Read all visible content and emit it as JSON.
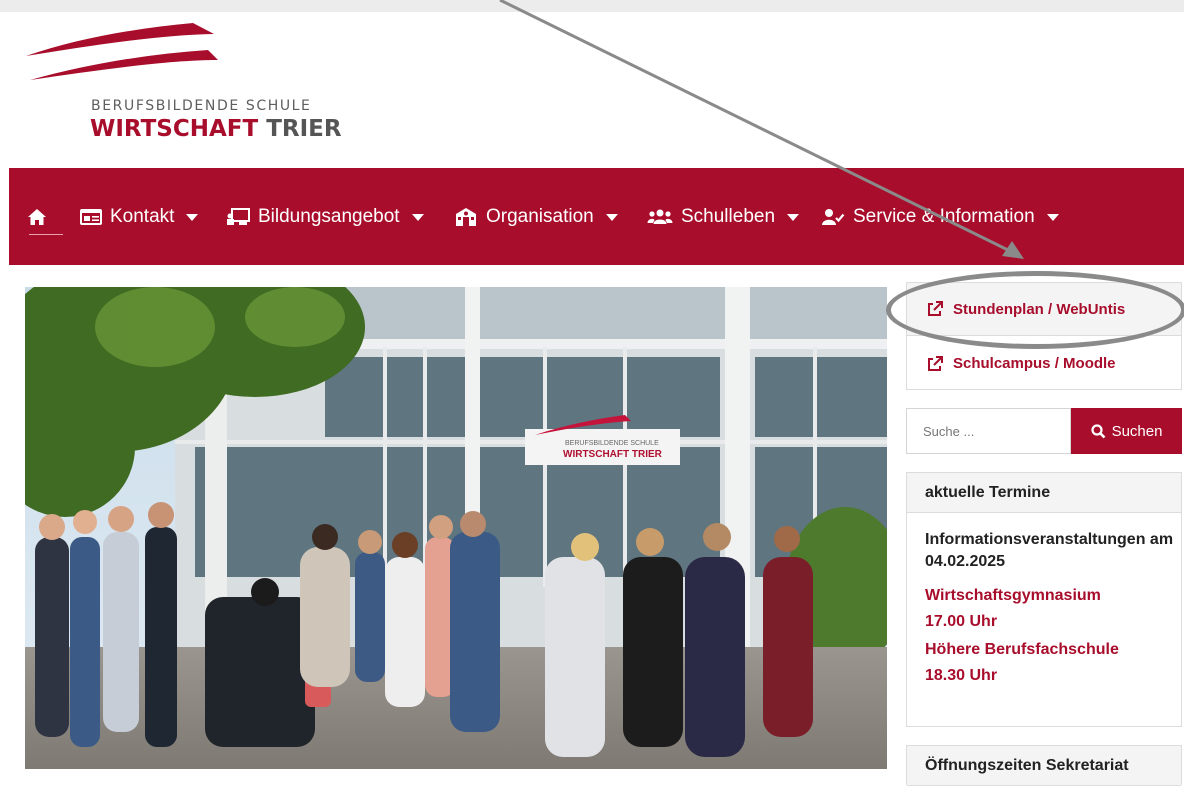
{
  "logo": {
    "line1": "BERUFSBILDENDE SCHULE",
    "line2_red": "WIRTSCHAFT",
    "line2_gray": " TRIER"
  },
  "nav": {
    "items": [
      {
        "label": "",
        "icon": "home-icon"
      },
      {
        "label": "Kontakt",
        "icon": "id-card-icon"
      },
      {
        "label": "Bildungsangebot",
        "icon": "chalkboard-icon"
      },
      {
        "label": "Organisation",
        "icon": "school-building-icon"
      },
      {
        "label": "Schulleben",
        "icon": "users-icon"
      },
      {
        "label": "Service & Information",
        "icon": "user-check-icon"
      }
    ]
  },
  "hero": {
    "sign_line1": "BERUFSBILDENDE SCHULE",
    "sign_line2": "WIRTSCHAFT TRIER"
  },
  "sidebar": {
    "links": [
      {
        "label": "Stundenplan / WebUntis",
        "icon": "external-link-icon"
      },
      {
        "label": "Schulcampus / Moodle",
        "icon": "external-link-icon"
      }
    ],
    "search": {
      "placeholder": "Suche ...",
      "button_label": "Suchen"
    },
    "termine": {
      "heading": "aktuelle Termine",
      "title": "Informationsveranstaltungen am 04.02.2025",
      "entries": [
        {
          "name": "Wirtschaftsgymnasium",
          "time": "17.00 Uhr"
        },
        {
          "name": "Höhere Berufsfachschule",
          "time": "18.30 Uhr"
        }
      ]
    },
    "oeffnungszeiten_heading": "Öffnungszeiten Sekretariat"
  },
  "colors": {
    "brand_red": "#a80e2c",
    "annotation_gray": "#8a8a8a"
  }
}
